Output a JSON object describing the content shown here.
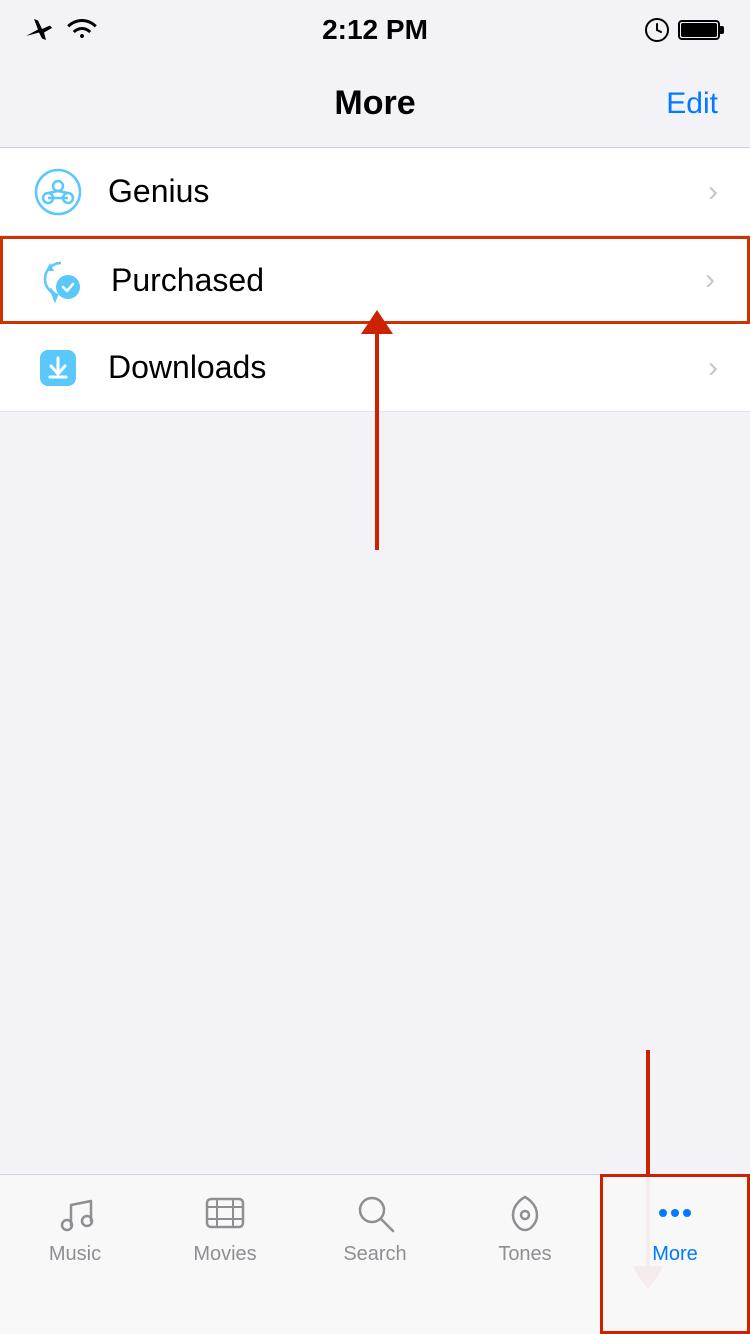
{
  "statusBar": {
    "time": "2:12 PM",
    "airplane": "✈",
    "wifi": "wifi"
  },
  "navBar": {
    "title": "More",
    "editLabel": "Edit"
  },
  "listItems": [
    {
      "id": "genius",
      "label": "Genius",
      "icon": "genius"
    },
    {
      "id": "purchased",
      "label": "Purchased",
      "icon": "purchased",
      "highlighted": true
    },
    {
      "id": "downloads",
      "label": "Downloads",
      "icon": "downloads"
    }
  ],
  "tabBar": {
    "items": [
      {
        "id": "music",
        "label": "Music",
        "icon": "music-note"
      },
      {
        "id": "movies",
        "label": "Movies",
        "icon": "film"
      },
      {
        "id": "search",
        "label": "Search",
        "icon": "search"
      },
      {
        "id": "tones",
        "label": "Tones",
        "icon": "bell"
      },
      {
        "id": "more",
        "label": "More",
        "icon": "dots",
        "active": true
      }
    ]
  }
}
